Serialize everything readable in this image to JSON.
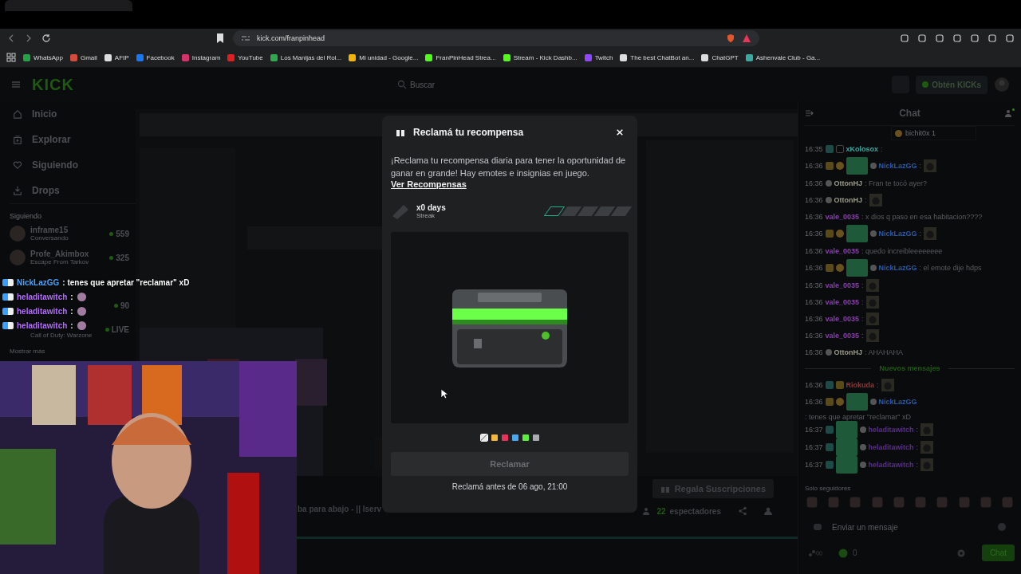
{
  "browser": {
    "url": "kick.com/franpinhead",
    "bookmarks": [
      {
        "label": "WhatsApp",
        "color": "#25a244"
      },
      {
        "label": "Gmail",
        "color": "#d54b3d"
      },
      {
        "label": "AFIP",
        "color": "#dddddd"
      },
      {
        "label": "Facebook",
        "color": "#1877f2"
      },
      {
        "label": "Instagram",
        "color": "#d6336c"
      },
      {
        "label": "YouTube",
        "color": "#e02020"
      },
      {
        "label": "Los Manijas del Rol...",
        "color": "#2fa84f"
      },
      {
        "label": "Mi unidad - Google...",
        "color": "#f4b400"
      },
      {
        "label": "FranPinHead Strea...",
        "color": "#53fc18"
      },
      {
        "label": "Stream - Kick Dashb...",
        "color": "#53fc18"
      },
      {
        "label": "Twitch",
        "color": "#9146ff"
      },
      {
        "label": "The best ChatBot an...",
        "color": "#dddddd"
      },
      {
        "label": "ChatGPT",
        "color": "#dddddd"
      },
      {
        "label": "Ashenvale Club - Ga...",
        "color": "#3aa99f"
      }
    ]
  },
  "header": {
    "logo": "KICK",
    "search": {
      "placeholder": "Buscar"
    },
    "kicks_button": "Obtén KICKs"
  },
  "sidebar": {
    "nav": [
      {
        "label": "Inicio"
      },
      {
        "label": "Explorar"
      },
      {
        "label": "Siguiendo"
      },
      {
        "label": "Drops"
      }
    ],
    "following_title": "Siguiendo",
    "channels": [
      {
        "name": "inframe15",
        "game": "Conversando",
        "viewers": "559",
        "live": true
      },
      {
        "name": "Profe_Akimbox",
        "game": "Escape From Tarkov",
        "viewers": "325",
        "live": true
      },
      {
        "viewers": "90",
        "live": true
      },
      {
        "game": "Call of Duty: Warzone",
        "viewers": "LIVE",
        "live": true
      }
    ],
    "show_more": "Mostrar más"
  },
  "stream": {
    "title": "ba para abajo - || Iserv",
    "gift_button": "Regala Suscripciones",
    "viewer_count": "22",
    "viewer_label": "espectadores"
  },
  "overlay_chat": [
    {
      "user": "NickLazGG",
      "color": "#4aa3ff",
      "text": ": tenes que apretar \"reclamar\" xD",
      "emote": false
    },
    {
      "user": "heladitawitch",
      "color": "#b46cff",
      "text": ":",
      "emote": true
    },
    {
      "user": "heladitawitch",
      "color": "#b46cff",
      "text": ":",
      "emote": true
    },
    {
      "user": "heladitawitch",
      "color": "#b46cff",
      "text": ":",
      "emote": true
    }
  ],
  "modal": {
    "title": "Reclamá tu recompensa",
    "description": "¡Reclama tu recompensa diaria para tener la oportunidad de ganar en grande! Hay emotes e insignias en juego.",
    "link": "Ver Recompensas",
    "streak": {
      "value": "x0 days",
      "label": "Streak",
      "segments": [
        {
          "active": true
        },
        {
          "active": false
        },
        {
          "active": false
        },
        {
          "active": false
        },
        {
          "active": false
        }
      ]
    },
    "swatches": [
      {
        "color": "#e8e8e8",
        "selected": true
      },
      {
        "color": "#f5b83d",
        "selected": false
      },
      {
        "color": "#e8325a",
        "selected": false
      },
      {
        "color": "#4aa8f0",
        "selected": false
      },
      {
        "color": "#5cf03c",
        "selected": false
      },
      {
        "color": "#a8acb0",
        "selected": false
      }
    ],
    "claim_button": {
      "label": "Reclamar",
      "disabled": true
    },
    "deadline": "Reclamá antes de 06 ago, 21:00"
  },
  "chat": {
    "title": "Chat",
    "pinned": "bichit0x 1",
    "messages": [
      {
        "kind": "newsub",
        "time": "16:35",
        "user": "xKolosox",
        "color": "#3aa99f",
        "text": ":",
        "emote": false
      },
      {
        "kind": "vip",
        "time": "16:36",
        "user": "NickLazGG",
        "color": "#2b5aa8",
        "text": ":",
        "emote": true
      },
      {
        "kind": "viewer",
        "time": "16:36",
        "user": "OttonHJ",
        "color": "#9a9a8a",
        "text": ": Fran te tocó ayer?",
        "emote": false
      },
      {
        "kind": "viewer",
        "time": "16:36",
        "user": "OttonHJ",
        "color": "#9a9a8a",
        "text": ":",
        "emote": true
      },
      {
        "kind": "plain",
        "time": "16:36",
        "user": "vale_0035",
        "color": "#8a3fb0",
        "text": ": x dios q paso en esa habitacion????",
        "emote": false
      },
      {
        "kind": "vip",
        "time": "16:36",
        "user": "NickLazGG",
        "color": "#2b5aa8",
        "text": ":",
        "emote": true
      },
      {
        "kind": "plain",
        "time": "16:36",
        "user": "vale_0035",
        "color": "#8a3fb0",
        "text": ": quedo increibleeeeeeee",
        "emote": false
      },
      {
        "kind": "vip",
        "time": "16:36",
        "user": "NickLazGG",
        "color": "#2b5aa8",
        "text": ": el emote dije hdps",
        "emote": false
      },
      {
        "kind": "plain",
        "time": "16:36",
        "user": "vale_0035",
        "color": "#8a3fb0",
        "text": ":",
        "emote": true
      },
      {
        "kind": "plain",
        "time": "16:36",
        "user": "vale_0035",
        "color": "#8a3fb0",
        "text": ":",
        "emote": true
      },
      {
        "kind": "plain",
        "time": "16:36",
        "user": "vale_0035",
        "color": "#8a3fb0",
        "text": ":",
        "emote": true
      },
      {
        "kind": "plain",
        "time": "16:36",
        "user": "vale_0035",
        "color": "#8a3fb0",
        "text": ":",
        "emote": true
      },
      {
        "kind": "viewer",
        "time": "16:36",
        "user": "OttonHJ",
        "color": "#9a9a8a",
        "text": ": AHAHAHA",
        "emote": false
      },
      {
        "kind": "divider",
        "text": "Nuevos mensajes"
      },
      {
        "kind": "subcrown",
        "time": "16:36",
        "user": "Riokuda",
        "color": "#8a3a3a",
        "text": ":",
        "emote": true
      },
      {
        "kind": "vip",
        "time": "16:36",
        "user": "NickLazGG",
        "color": "#2b5aa8",
        "text": ": tenes que apretar \"reclamar\" xD",
        "emote": false
      },
      {
        "kind": "sub",
        "time": "16:37",
        "user": "heladitawitch",
        "color": "#5a2f8a",
        "text": ":",
        "emote": true
      },
      {
        "kind": "sub",
        "time": "16:37",
        "user": "heladitawitch",
        "color": "#5a2f8a",
        "text": ":",
        "emote": true
      },
      {
        "kind": "sub",
        "time": "16:37",
        "user": "heladitawitch",
        "color": "#5a2f8a",
        "text": ":",
        "emote": true
      }
    ],
    "mode": "Solo seguidores",
    "input": {
      "placeholder": "Enviar un mensaje"
    },
    "kicks_count": "0",
    "send_button": "Chat"
  }
}
